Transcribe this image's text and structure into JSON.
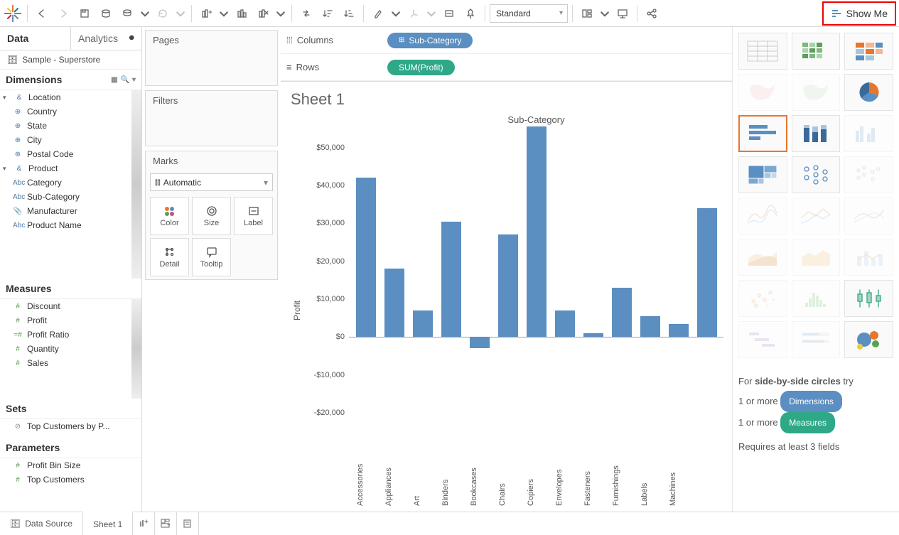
{
  "toolbar": {
    "fit_mode": "Standard",
    "show_me_label": "Show Me"
  },
  "data_pane": {
    "tab_data": "Data",
    "tab_analytics": "Analytics",
    "datasource": "Sample - Superstore",
    "dimensions_label": "Dimensions",
    "measures_label": "Measures",
    "sets_label": "Sets",
    "parameters_label": "Parameters",
    "dims": {
      "location": "Location",
      "country": "Country",
      "state": "State",
      "city": "City",
      "postal": "Postal Code",
      "product": "Product",
      "category": "Category",
      "subcategory": "Sub-Category",
      "manufacturer": "Manufacturer",
      "productname": "Product Name"
    },
    "meas": {
      "discount": "Discount",
      "profit": "Profit",
      "profit_ratio": "Profit Ratio",
      "quantity": "Quantity",
      "sales": "Sales"
    },
    "sets": {
      "top_customers": "Top Customers by P..."
    },
    "params": {
      "profit_bin": "Profit Bin Size",
      "top_customers": "Top Customers"
    }
  },
  "cards": {
    "pages": "Pages",
    "filters": "Filters",
    "marks": "Marks",
    "mark_type": "Automatic",
    "color": "Color",
    "size": "Size",
    "label": "Label",
    "detail": "Detail",
    "tooltip": "Tooltip"
  },
  "shelves": {
    "columns_label": "Columns",
    "rows_label": "Rows",
    "columns_pill": "Sub-Category",
    "rows_pill": "SUM(Profit)"
  },
  "viz": {
    "title": "Sheet 1",
    "header": "Sub-Category",
    "ylabel": "Profit"
  },
  "showme_panel": {
    "line1_pre": "For ",
    "line1_bold": "side-by-side circles",
    "line1_post": " try",
    "line2_pre": "1 or more ",
    "line2_pill": "Dimensions",
    "line3_pre": "1 or more ",
    "line3_pill": "Measures",
    "line4": "Requires at least 3 fields"
  },
  "footer": {
    "datasource": "Data Source",
    "sheet1": "Sheet 1"
  },
  "chart_data": {
    "type": "bar",
    "title": "Sheet 1",
    "xlabel": "Sub-Category",
    "ylabel": "Profit",
    "ylim": [
      -20000,
      55000
    ],
    "yticks": [
      "-$20,000",
      "-$10,000",
      "$0",
      "$10,000",
      "$20,000",
      "$30,000",
      "$40,000",
      "$50,000"
    ],
    "ytick_vals": [
      -20000,
      -10000,
      0,
      10000,
      20000,
      30000,
      40000,
      50000
    ],
    "categories": [
      "Accessories",
      "Appliances",
      "Art",
      "Binders",
      "Bookcases",
      "Chairs",
      "Copiers",
      "Envelopes",
      "Fasteners",
      "Furnishings",
      "Labels",
      "Machines"
    ],
    "values": [
      42000,
      18000,
      7000,
      30500,
      -3000,
      27000,
      55500,
      7000,
      1000,
      13000,
      5500,
      3500
    ],
    "partial_next": 34000
  }
}
